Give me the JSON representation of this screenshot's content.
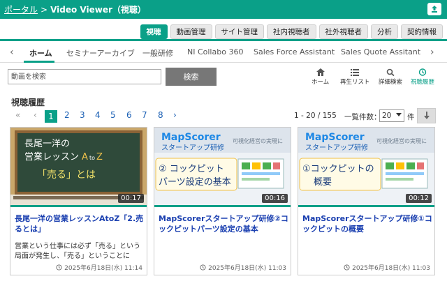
{
  "header": {
    "portal_link": "ポータル",
    "separator": ">",
    "title": "Video Viewer（視聴）"
  },
  "menu": {
    "items": [
      "視聴",
      "動画管理",
      "サイト管理",
      "社内視聴者",
      "社外視聴者",
      "分析",
      "契約情報"
    ],
    "active": "視聴"
  },
  "tabs": {
    "items": [
      "ホーム",
      "セミナーアーカイブ",
      "一般研修",
      "NI Collabo 360",
      "Sales Force Assistant",
      "Sales Quote Assitant"
    ],
    "active": "ホーム"
  },
  "search": {
    "placeholder": "動画を検索",
    "button_label": "検索"
  },
  "tools": {
    "home": "ホーム",
    "playlist": "再生リスト",
    "advanced_search": "詳細検索",
    "history": "視聴履歴"
  },
  "section_title": "視聴履歴",
  "pagination": {
    "first": "«",
    "prev": "‹",
    "pages": [
      "1",
      "2",
      "3",
      "4",
      "5",
      "6",
      "7",
      "8"
    ],
    "current": "1",
    "next": "›",
    "count_text": "1 - 20 / 155",
    "per_page_label": "一覧件数：",
    "per_page_value": "20",
    "unit": "件"
  },
  "cards": [
    {
      "duration": "00:17",
      "title": "長尾一洋の営業レッスンAtoZ「2.売るとは」",
      "description": "営業という仕事には必ず「売る」という局面が発生し、「売る」ということに",
      "date": "2025年6月18日(水) 11:14",
      "thumb": {
        "line1": "長尾一洋の",
        "line2": "営業レッスン",
        "atoz_a": "A",
        "atoz_to": "to",
        "atoz_z": "Z",
        "line3": "「売る」とは"
      }
    },
    {
      "duration": "00:16",
      "title": "MapScorerスタートアップ研修②コックピットパーツ設定の基本",
      "description": "",
      "date": "2025年6月18日(水) 11:03",
      "thumb": {
        "brand": "MapScorer",
        "sub": "スタートアップ研修",
        "tagline": "可視化経営の実現に",
        "line1": "② コックピット",
        "line2": "パーツ設定の基本"
      }
    },
    {
      "duration": "00:12",
      "title": "MapScorerスタートアップ研修①コックピットの概要",
      "description": "",
      "date": "2025年6月18日(水) 11:03",
      "thumb": {
        "brand": "MapScorer",
        "sub": "スタートアップ研修",
        "tagline": "可視化経営の実現に",
        "line1": "①コックピットの",
        "line2": "概要"
      }
    }
  ],
  "colors": {
    "accent": "#0aa088",
    "link": "#1a3fb0"
  }
}
